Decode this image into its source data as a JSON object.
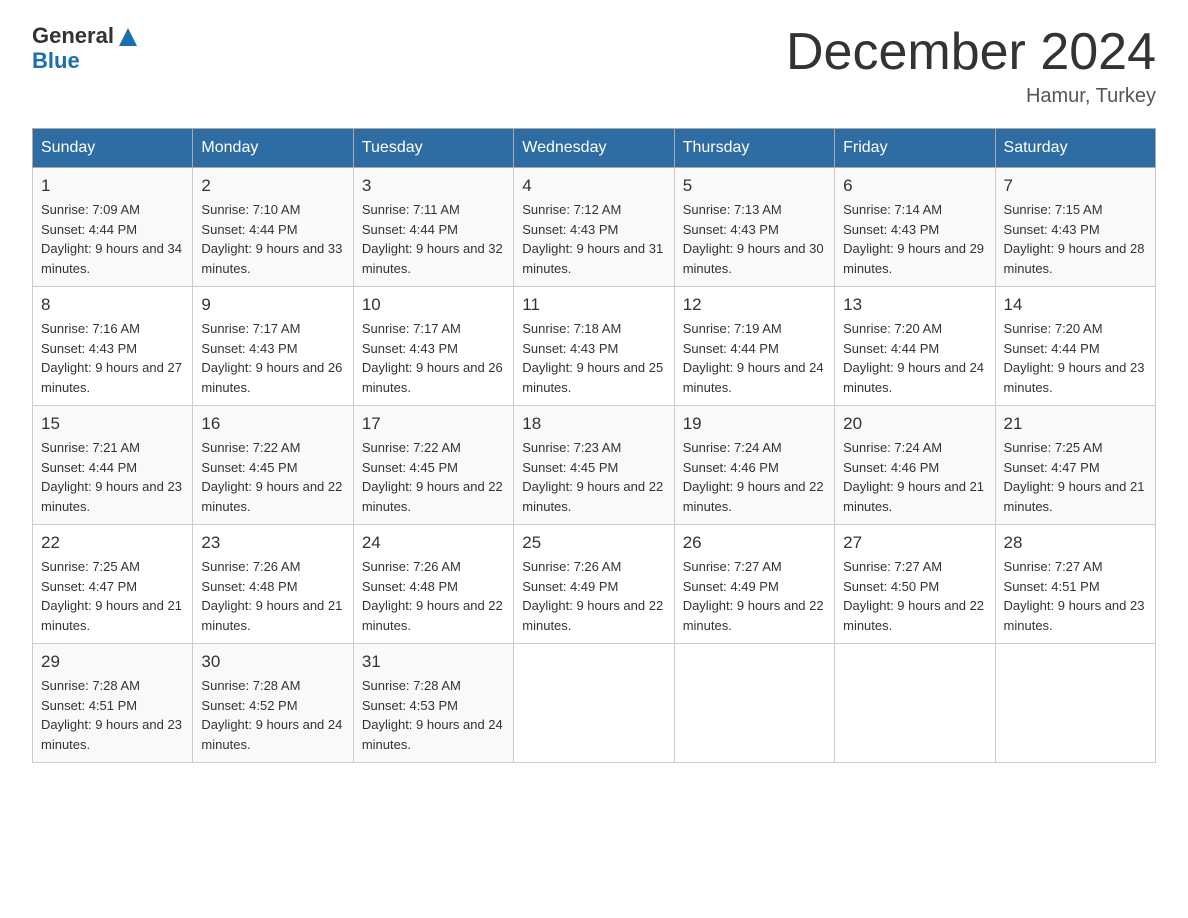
{
  "header": {
    "logo_line1": "General",
    "logo_line2": "Blue",
    "month_title": "December 2024",
    "location": "Hamur, Turkey"
  },
  "days_of_week": [
    "Sunday",
    "Monday",
    "Tuesday",
    "Wednesday",
    "Thursday",
    "Friday",
    "Saturday"
  ],
  "weeks": [
    [
      {
        "day": "1",
        "sunrise": "7:09 AM",
        "sunset": "4:44 PM",
        "daylight": "9 hours and 34 minutes."
      },
      {
        "day": "2",
        "sunrise": "7:10 AM",
        "sunset": "4:44 PM",
        "daylight": "9 hours and 33 minutes."
      },
      {
        "day": "3",
        "sunrise": "7:11 AM",
        "sunset": "4:44 PM",
        "daylight": "9 hours and 32 minutes."
      },
      {
        "day": "4",
        "sunrise": "7:12 AM",
        "sunset": "4:43 PM",
        "daylight": "9 hours and 31 minutes."
      },
      {
        "day": "5",
        "sunrise": "7:13 AM",
        "sunset": "4:43 PM",
        "daylight": "9 hours and 30 minutes."
      },
      {
        "day": "6",
        "sunrise": "7:14 AM",
        "sunset": "4:43 PM",
        "daylight": "9 hours and 29 minutes."
      },
      {
        "day": "7",
        "sunrise": "7:15 AM",
        "sunset": "4:43 PM",
        "daylight": "9 hours and 28 minutes."
      }
    ],
    [
      {
        "day": "8",
        "sunrise": "7:16 AM",
        "sunset": "4:43 PM",
        "daylight": "9 hours and 27 minutes."
      },
      {
        "day": "9",
        "sunrise": "7:17 AM",
        "sunset": "4:43 PM",
        "daylight": "9 hours and 26 minutes."
      },
      {
        "day": "10",
        "sunrise": "7:17 AM",
        "sunset": "4:43 PM",
        "daylight": "9 hours and 26 minutes."
      },
      {
        "day": "11",
        "sunrise": "7:18 AM",
        "sunset": "4:43 PM",
        "daylight": "9 hours and 25 minutes."
      },
      {
        "day": "12",
        "sunrise": "7:19 AM",
        "sunset": "4:44 PM",
        "daylight": "9 hours and 24 minutes."
      },
      {
        "day": "13",
        "sunrise": "7:20 AM",
        "sunset": "4:44 PM",
        "daylight": "9 hours and 24 minutes."
      },
      {
        "day": "14",
        "sunrise": "7:20 AM",
        "sunset": "4:44 PM",
        "daylight": "9 hours and 23 minutes."
      }
    ],
    [
      {
        "day": "15",
        "sunrise": "7:21 AM",
        "sunset": "4:44 PM",
        "daylight": "9 hours and 23 minutes."
      },
      {
        "day": "16",
        "sunrise": "7:22 AM",
        "sunset": "4:45 PM",
        "daylight": "9 hours and 22 minutes."
      },
      {
        "day": "17",
        "sunrise": "7:22 AM",
        "sunset": "4:45 PM",
        "daylight": "9 hours and 22 minutes."
      },
      {
        "day": "18",
        "sunrise": "7:23 AM",
        "sunset": "4:45 PM",
        "daylight": "9 hours and 22 minutes."
      },
      {
        "day": "19",
        "sunrise": "7:24 AM",
        "sunset": "4:46 PM",
        "daylight": "9 hours and 22 minutes."
      },
      {
        "day": "20",
        "sunrise": "7:24 AM",
        "sunset": "4:46 PM",
        "daylight": "9 hours and 21 minutes."
      },
      {
        "day": "21",
        "sunrise": "7:25 AM",
        "sunset": "4:47 PM",
        "daylight": "9 hours and 21 minutes."
      }
    ],
    [
      {
        "day": "22",
        "sunrise": "7:25 AM",
        "sunset": "4:47 PM",
        "daylight": "9 hours and 21 minutes."
      },
      {
        "day": "23",
        "sunrise": "7:26 AM",
        "sunset": "4:48 PM",
        "daylight": "9 hours and 21 minutes."
      },
      {
        "day": "24",
        "sunrise": "7:26 AM",
        "sunset": "4:48 PM",
        "daylight": "9 hours and 22 minutes."
      },
      {
        "day": "25",
        "sunrise": "7:26 AM",
        "sunset": "4:49 PM",
        "daylight": "9 hours and 22 minutes."
      },
      {
        "day": "26",
        "sunrise": "7:27 AM",
        "sunset": "4:49 PM",
        "daylight": "9 hours and 22 minutes."
      },
      {
        "day": "27",
        "sunrise": "7:27 AM",
        "sunset": "4:50 PM",
        "daylight": "9 hours and 22 minutes."
      },
      {
        "day": "28",
        "sunrise": "7:27 AM",
        "sunset": "4:51 PM",
        "daylight": "9 hours and 23 minutes."
      }
    ],
    [
      {
        "day": "29",
        "sunrise": "7:28 AM",
        "sunset": "4:51 PM",
        "daylight": "9 hours and 23 minutes."
      },
      {
        "day": "30",
        "sunrise": "7:28 AM",
        "sunset": "4:52 PM",
        "daylight": "9 hours and 24 minutes."
      },
      {
        "day": "31",
        "sunrise": "7:28 AM",
        "sunset": "4:53 PM",
        "daylight": "9 hours and 24 minutes."
      },
      null,
      null,
      null,
      null
    ]
  ],
  "labels": {
    "sunrise": "Sunrise:",
    "sunset": "Sunset:",
    "daylight": "Daylight:"
  }
}
